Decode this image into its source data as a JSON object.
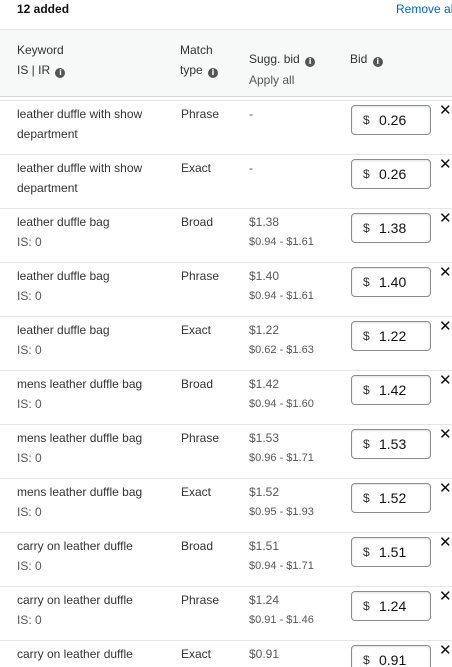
{
  "header": {
    "count_label": "12 added",
    "remove_all_label": "Remove al"
  },
  "columns": {
    "keyword": "Keyword",
    "keyword_sub": "IS | IR",
    "match": "Match",
    "match_sub": "type",
    "sugg_bid": "Sugg. bid",
    "apply_all": "Apply all",
    "bid": "Bid"
  },
  "currency_symbol": "$",
  "remove_icon_glyph": "✕",
  "rows": [
    {
      "keyword": "leather duffle with show department",
      "is": "",
      "match": "Phrase",
      "sugg": "-",
      "range": "",
      "bid": "0.26"
    },
    {
      "keyword": "leather duffle with show department",
      "is": "",
      "match": "Exact",
      "sugg": "-",
      "range": "",
      "bid": "0.26"
    },
    {
      "keyword": "leather duffle bag",
      "is": "IS: 0",
      "match": "Broad",
      "sugg": "$1.38",
      "range": "$0.94 - $1.61",
      "bid": "1.38"
    },
    {
      "keyword": "leather duffle bag",
      "is": "IS: 0",
      "match": "Phrase",
      "sugg": "$1.40",
      "range": "$0.94 - $1.61",
      "bid": "1.40"
    },
    {
      "keyword": "leather duffle bag",
      "is": "IS: 0",
      "match": "Exact",
      "sugg": "$1.22",
      "range": "$0.62 - $1.63",
      "bid": "1.22"
    },
    {
      "keyword": "mens leather duffle bag",
      "is": "IS: 0",
      "match": "Broad",
      "sugg": "$1.42",
      "range": "$0.94 - $1.60",
      "bid": "1.42"
    },
    {
      "keyword": "mens leather duffle bag",
      "is": "IS: 0",
      "match": "Phrase",
      "sugg": "$1.53",
      "range": "$0.96 - $1.71",
      "bid": "1.53"
    },
    {
      "keyword": "mens leather duffle bag",
      "is": "IS: 0",
      "match": "Exact",
      "sugg": "$1.52",
      "range": "$0.95 - $1.93",
      "bid": "1.52"
    },
    {
      "keyword": "carry on leather duffle",
      "is": "IS: 0",
      "match": "Broad",
      "sugg": "$1.51",
      "range": "$0.94 - $1.71",
      "bid": "1.51"
    },
    {
      "keyword": "carry on leather duffle",
      "is": "IS: 0",
      "match": "Phrase",
      "sugg": "$1.24",
      "range": "$0.91 - $1.46",
      "bid": "1.24"
    },
    {
      "keyword": "carry on leather duffle",
      "is": "",
      "match": "Exact",
      "sugg": "$0.91",
      "range": "",
      "bid": "0.91"
    }
  ]
}
